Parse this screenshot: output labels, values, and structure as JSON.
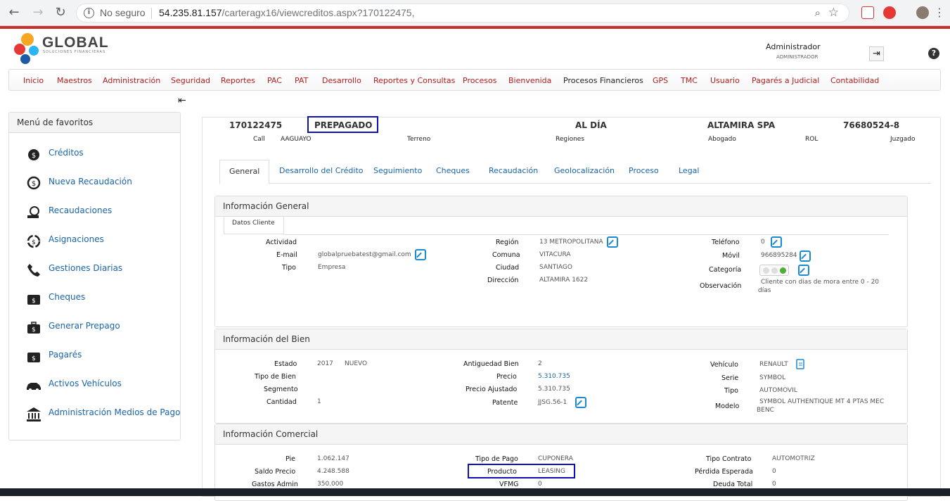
{
  "browser": {
    "security_label": "No seguro",
    "url_host": "54.235.81.157",
    "url_path": "/carteragx16/viewcreditos.aspx?170122475,"
  },
  "brand": {
    "name": "GLOBAL",
    "tagline": "SOLUCIONES FINANCIERAS"
  },
  "user": {
    "name": "Administrador",
    "role": "ADMINISTRADOR"
  },
  "menu": [
    "Inicio",
    "Maestros",
    "Administración",
    "Seguridad",
    "Reportes",
    "PAC",
    "PAT",
    "Desarrollo",
    "Reportes y Consultas",
    "Procesos",
    "Bienvenida",
    "Procesos Financieros",
    "GPS",
    "TMC",
    "Usuario",
    "Pagarés a Judicial",
    "Contabilidad"
  ],
  "favorites": {
    "title": "Menú de favoritos",
    "items": [
      "Créditos",
      "Nueva Recaudación",
      "Recaudaciones",
      "Asignaciones",
      "Gestiones Diarias",
      "Cheques",
      "Generar Prepago",
      "Pagarés",
      "Activos Vehículos",
      "Administración Medios de Pago"
    ]
  },
  "credit": {
    "number": "170122475",
    "status": "PREPAGADO",
    "state": "AL DÍA",
    "client": "ALTAMIRA SPA",
    "rut": "76680524-8",
    "call_label": "Call",
    "call_value": "AAGUAYO",
    "terreno_label": "Terreno",
    "regiones_label": "Regiones",
    "abogado_label": "Abogado",
    "rol_label": "ROL",
    "juzgado_label": "Juzgado"
  },
  "tabs": [
    "General",
    "Desarrollo del Crédito",
    "Seguimiento",
    "Cheques",
    "Recaudación",
    "Geolocalización",
    "Proceso",
    "Legal"
  ],
  "general": {
    "title": "Información General",
    "subtab": "Datos Cliente",
    "actividad_label": "Actividad",
    "email_label": "E-mail",
    "email": "globalpruebatest@gmail.com",
    "tipo_label": "Tipo",
    "tipo": "Empresa",
    "region_label": "Región",
    "region": "13 METROPOLITANA",
    "comuna_label": "Comuna",
    "comuna": "VITACURA",
    "ciudad_label": "Ciudad",
    "ciudad": "SANTIAGO",
    "direccion_label": "Dirección",
    "direccion": "ALTAMIRA 1622",
    "telefono_label": "Teléfono",
    "telefono": "0",
    "movil_label": "Móvil",
    "movil": "966895284",
    "categoria_label": "Categoría",
    "observacion_label": "Observación",
    "observacion_1": "Cliente con dias de mora entre 0 - 20",
    "observacion_2": "días"
  },
  "bien": {
    "title": "Información del Bien",
    "estado_label": "Estado",
    "estado_year": "2017",
    "estado": "NUEVO",
    "tipo_bien_label": "Tipo de Bien",
    "segmento_label": "Segmento",
    "cantidad_label": "Cantidad",
    "cantidad": "1",
    "antiguedad_label": "Antiguedad Bien",
    "antiguedad": "2",
    "precio_label": "Precio",
    "precio": "5.310.735",
    "precio_aj_label": "Precio Ajustado",
    "precio_aj": "5.310.735",
    "patente_label": "Patente",
    "patente": "JJSG.56-1",
    "vehiculo_label": "Vehículo",
    "vehiculo": "RENAULT",
    "serie_label": "Serie",
    "serie": "SYMBOL",
    "tipo_label": "Tipo",
    "tipo": "AUTOMOVIL",
    "modelo_label": "Modelo",
    "modelo_1": "SYMBOL AUTHENTIQUE MT 4 PTAS MEC",
    "modelo_2": "BENC"
  },
  "comercial": {
    "title": "Información Comercial",
    "pie_label": "Pie",
    "pie": "1.062.147",
    "saldo_label": "Saldo Precio",
    "saldo": "4.248.588",
    "gastos_label": "Gastos Admin",
    "gastos": "350.000",
    "tipo_pago_label": "Tipo de Pago",
    "tipo_pago": "CUPONERA",
    "producto_label": "Producto",
    "producto": "LEASING",
    "vfmg_label": "VFMG",
    "vfmg": "0",
    "tipo_contrato_label": "Tipo Contrato",
    "tipo_contrato": "AUTOMOTRIZ",
    "perdida_label": "Pérdida Esperada",
    "perdida": "0",
    "deuda_label": "Deuda Total",
    "deuda": "0"
  },
  "colors": {
    "menu_red": "#b01e1e",
    "link_blue": "#1a64a8",
    "highlight": "#1010b8",
    "category_green": "#4caf3a"
  }
}
